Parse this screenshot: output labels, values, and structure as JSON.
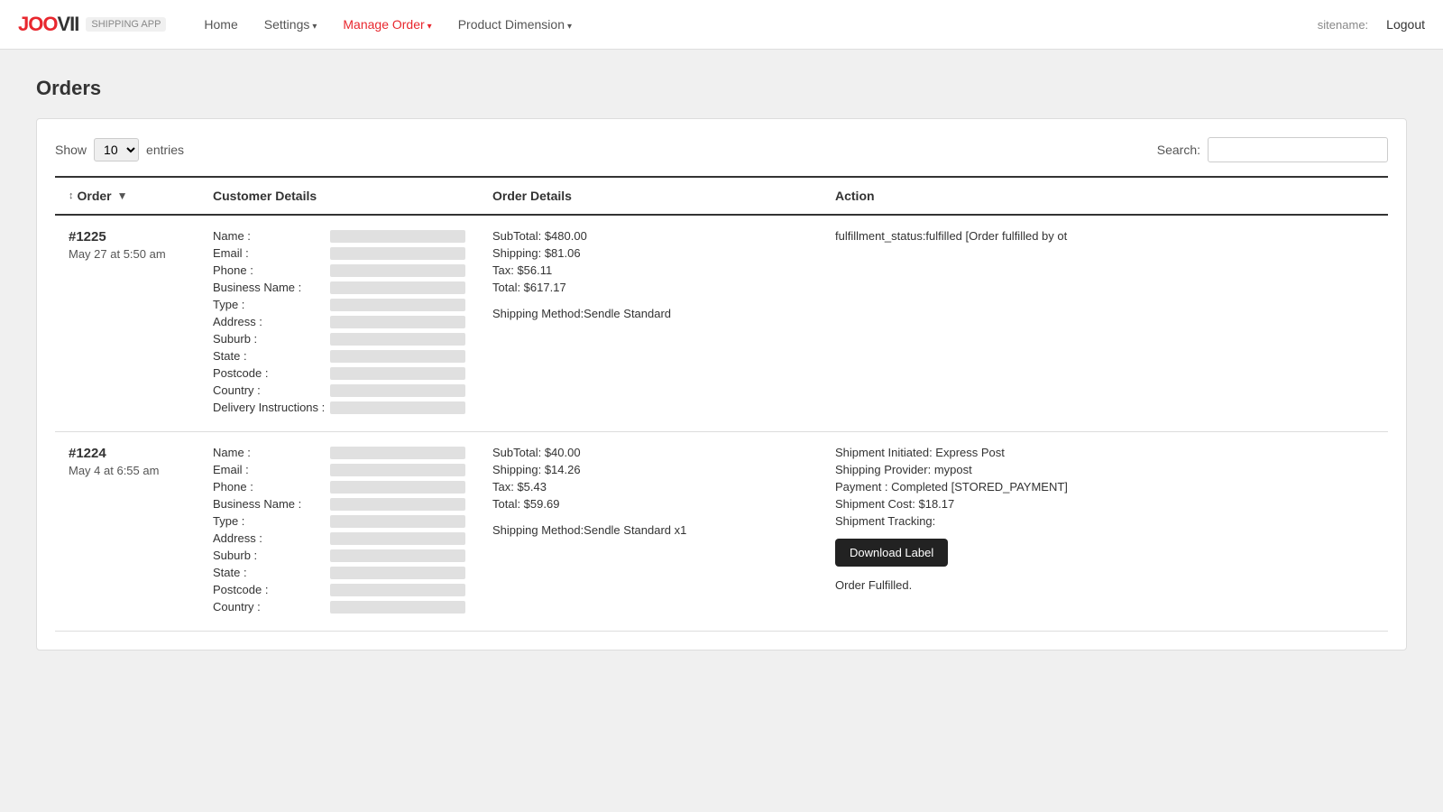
{
  "brand": {
    "logo_red": "JOO",
    "logo_black": "VII",
    "app_label": "SHIPPING APP"
  },
  "nav": {
    "home": "Home",
    "settings": "Settings",
    "manage_order": "Manage Order",
    "product_dimension": "Product Dimension",
    "sitename_label": "sitename:",
    "logout": "Logout"
  },
  "page": {
    "title": "Orders"
  },
  "table_controls": {
    "show_label": "Show",
    "entries_value": "10",
    "entries_label": "entries",
    "search_label": "Search:"
  },
  "table": {
    "col_order": "Order",
    "col_customer": "Customer Details",
    "col_details": "Order Details",
    "col_action": "Action"
  },
  "rows": [
    {
      "order_id": "#1225",
      "order_date": "May 27 at 5:50 am",
      "customer_fields": [
        "Name :",
        "Email :",
        "Phone :",
        "Business Name :",
        "Type :",
        "Address :",
        "Suburb :",
        "State :",
        "Postcode :",
        "Country :",
        "Delivery Instructions :"
      ],
      "order_lines": [
        "SubTotal: $480.00",
        "Shipping: $81.06",
        "Tax: $56.11",
        "Total: $617.17",
        "",
        "Shipping Method:Sendle Standard"
      ],
      "action_text": "fulfillment_status:fulfilled [Order fulfilled by ot",
      "has_download": false
    },
    {
      "order_id": "#1224",
      "order_date": "May 4 at 6:55 am",
      "customer_fields": [
        "Name :",
        "Email :",
        "Phone :",
        "Business Name :",
        "Type :",
        "Address :",
        "Suburb :",
        "State :",
        "Postcode :",
        "Country :"
      ],
      "order_lines": [
        "SubTotal: $40.00",
        "Shipping: $14.26",
        "Tax: $5.43",
        "Total: $59.69",
        "",
        "Shipping Method:Sendle Standard x1"
      ],
      "action_lines": [
        "Shipment Initiated: Express Post",
        "Shipping Provider: mypost",
        "Payment : Completed [STORED_PAYMENT]",
        "Shipment Cost: $18.17",
        "Shipment Tracking:"
      ],
      "download_label": "Download Label",
      "fulfilled_label": "Order Fulfilled.",
      "has_download": true
    }
  ]
}
